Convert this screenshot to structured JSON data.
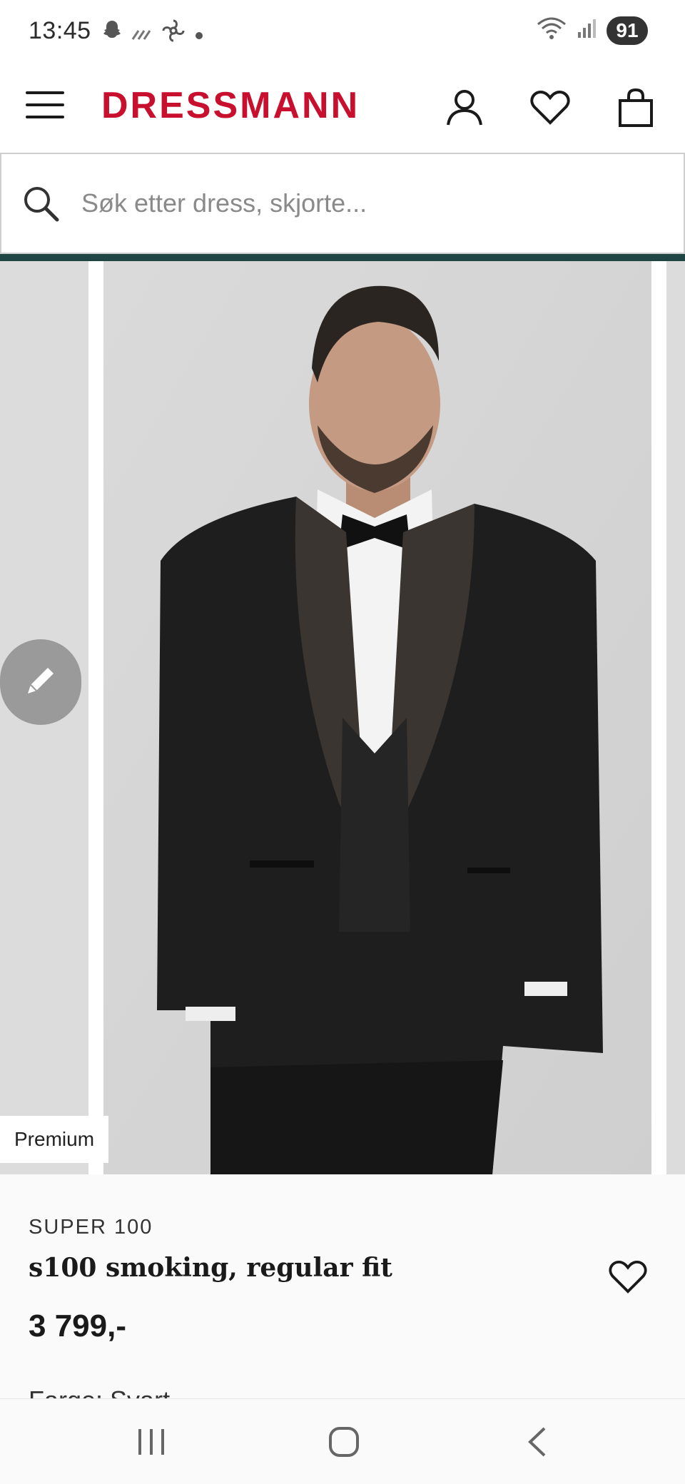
{
  "status_bar": {
    "time": "13:45",
    "battery": "91",
    "icons_left": [
      "snapchat-icon",
      "signal-weak-icon",
      "fan-icon",
      "dot-icon"
    ],
    "icons_right": [
      "wifi-6e-icon",
      "cell-signal-icon"
    ]
  },
  "header": {
    "logo": "DRESSMANN",
    "accent_color": "#c8102e",
    "icons": [
      "menu-icon",
      "account-icon",
      "wishlist-heart-icon",
      "shopping-bag-icon"
    ]
  },
  "search": {
    "placeholder": "Søk etter dress, skjorte...",
    "value": ""
  },
  "gallery": {
    "badge": "Premium",
    "edit_icon": "pencil-icon"
  },
  "product": {
    "brand": "SUPER 100",
    "name": "s100 smoking, regular fit",
    "price": "3 799,-",
    "color_label": "Farge: Svart"
  },
  "navbar": {
    "buttons": [
      "recent-apps-icon",
      "home-icon",
      "back-icon"
    ]
  }
}
